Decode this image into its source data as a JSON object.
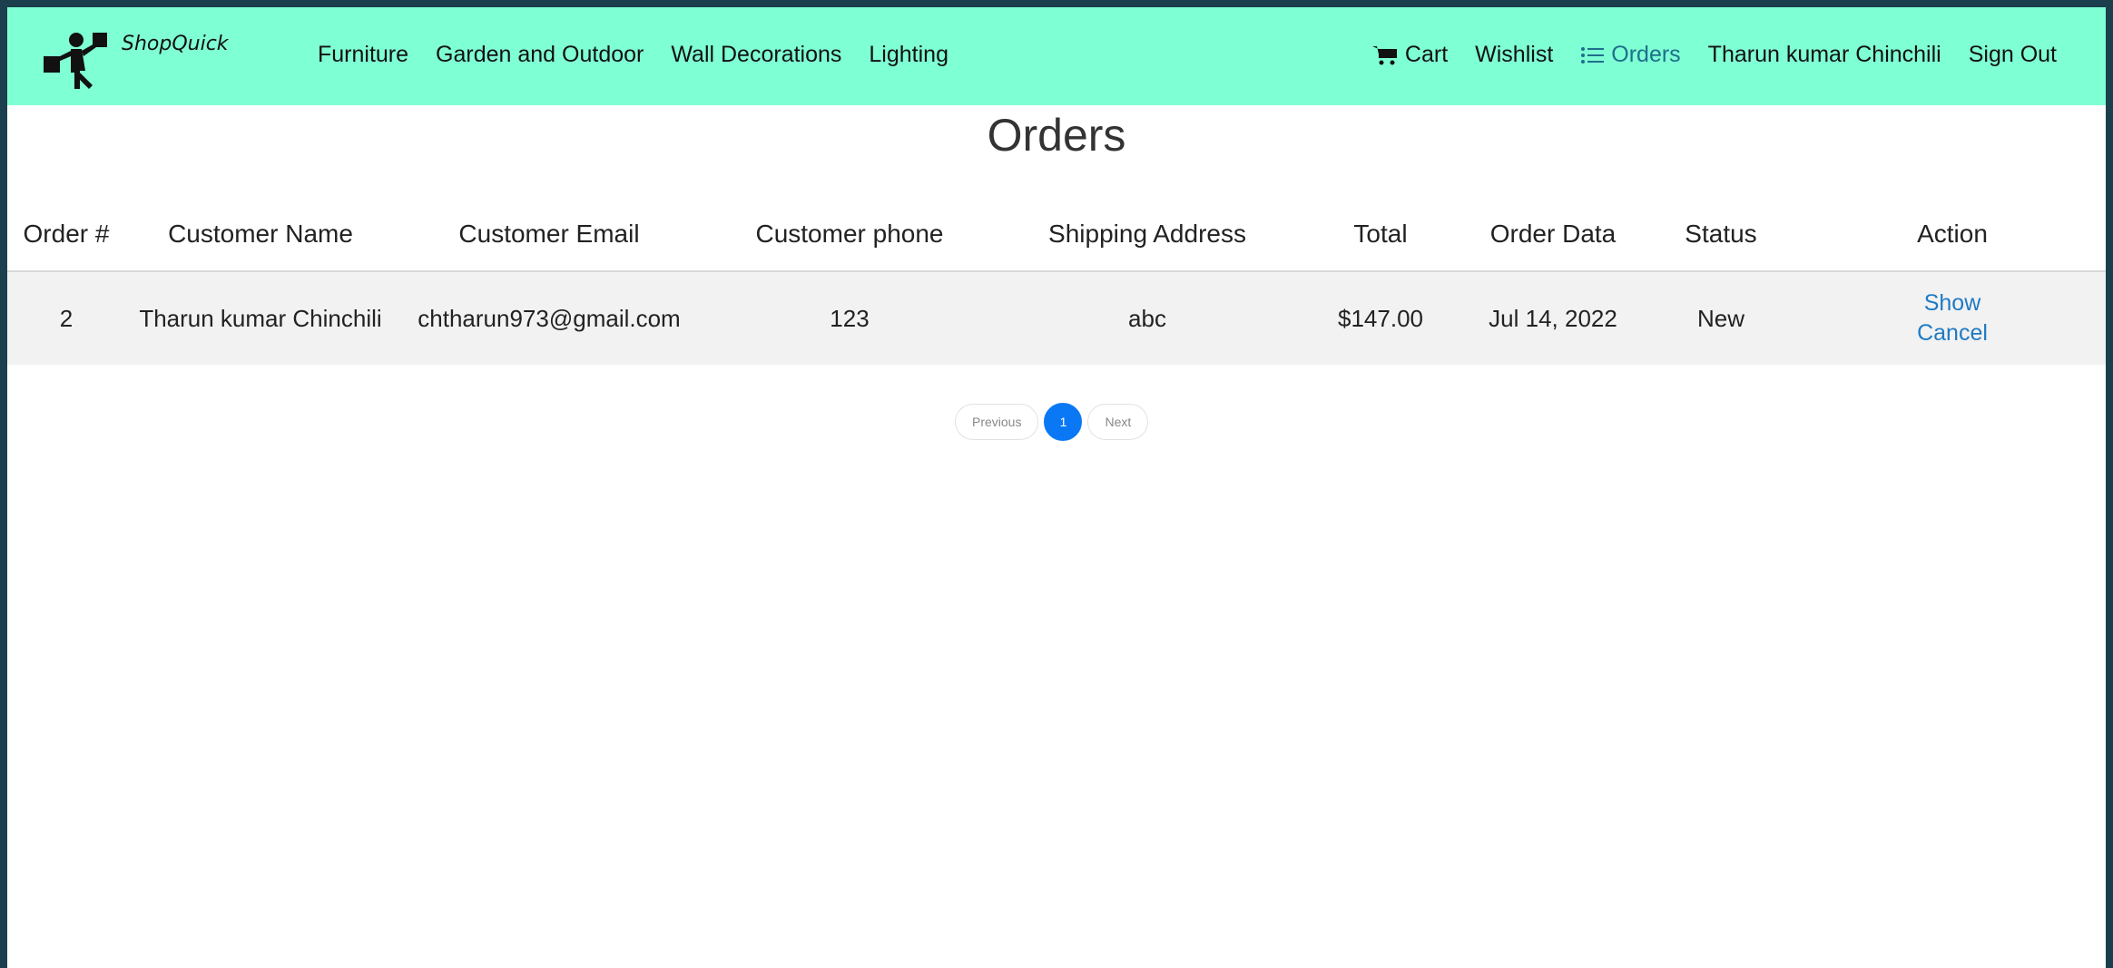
{
  "brand": {
    "name": "ShopQuick"
  },
  "nav": {
    "categories": [
      "Furniture",
      "Garden and Outdoor",
      "Wall Decorations",
      "Lighting"
    ],
    "cart": "Cart",
    "wishlist": "Wishlist",
    "orders": "Orders",
    "user": "Tharun kumar Chinchili",
    "signout": "Sign Out"
  },
  "page": {
    "title": "Orders"
  },
  "table": {
    "headers": [
      "Order #",
      "Customer Name",
      "Customer Email",
      "Customer phone",
      "Shipping Address",
      "Total",
      "Order Data",
      "Status",
      "Action"
    ],
    "rows": [
      {
        "order": "2",
        "name": "Tharun kumar Chinchili",
        "email": "chtharun973@gmail.com",
        "phone": "123",
        "address": "abc",
        "total": "$147.00",
        "date": "Jul 14, 2022",
        "status": "New",
        "action_show": "Show",
        "action_cancel": "Cancel"
      }
    ]
  },
  "pagination": {
    "previous": "Previous",
    "current": "1",
    "next": "Next"
  },
  "colors": {
    "navbar": "#7fffd4",
    "link": "#1f7ac4",
    "active_page": "#0a78f5",
    "outer": "#1b3f4d"
  }
}
